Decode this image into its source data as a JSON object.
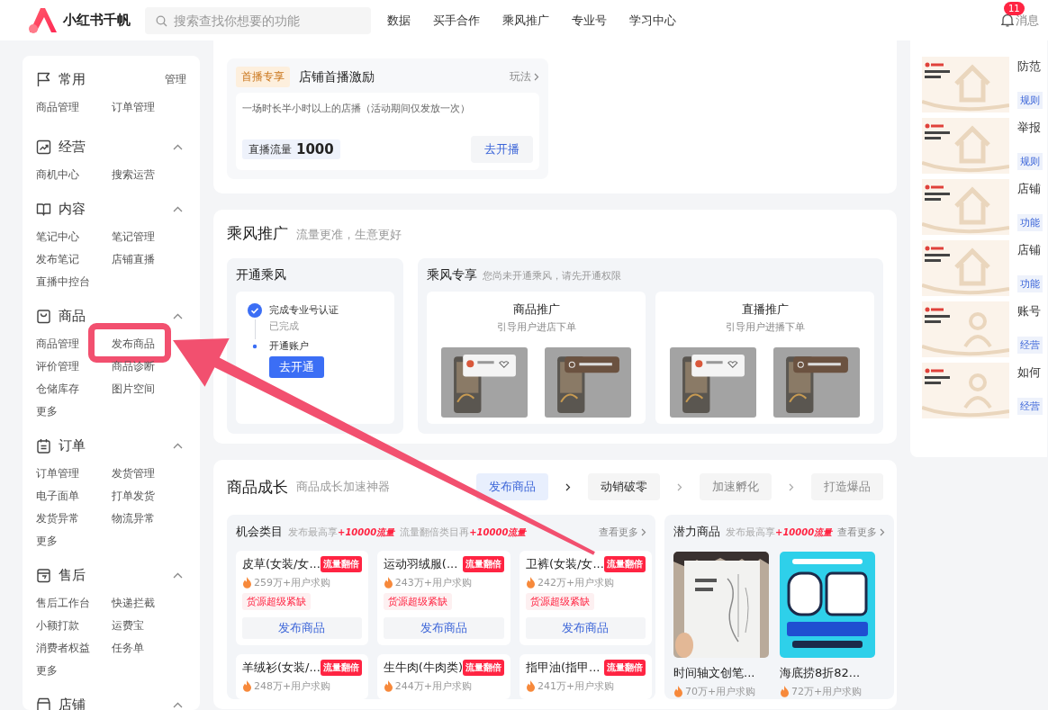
{
  "header": {
    "brand": "小红书千帆",
    "search": {
      "placeholder": "搜索查找你想要的功能"
    },
    "nav": [
      "数据",
      "买手合作",
      "乘风推广",
      "专业号",
      "学习中心"
    ],
    "notifications": {
      "badge": "11",
      "label": "消息"
    }
  },
  "sidebar": {
    "groups": [
      {
        "title": "常用",
        "action": "管理",
        "items": [
          {
            "label": "商品管理",
            "highlighted": false
          },
          {
            "label": "订单管理",
            "highlighted": false
          }
        ]
      },
      {
        "title": "经营",
        "expanded": true,
        "items": [
          {
            "label": "商机中心",
            "highlighted": false
          },
          {
            "label": "搜索运营",
            "highlighted": false
          }
        ]
      },
      {
        "title": "内容",
        "expanded": true,
        "items": [
          {
            "label": "笔记中心",
            "highlighted": false
          },
          {
            "label": "笔记管理",
            "highlighted": false
          },
          {
            "label": "发布笔记",
            "highlighted": false
          },
          {
            "label": "店铺直播",
            "highlighted": false
          },
          {
            "label": "直播中控台",
            "highlighted": false
          }
        ]
      },
      {
        "title": "商品",
        "expanded": true,
        "items": [
          {
            "label": "商品管理",
            "highlighted": false
          },
          {
            "label": "发布商品",
            "highlighted": true
          },
          {
            "label": "评价管理",
            "highlighted": false
          },
          {
            "label": "商品诊断",
            "highlighted": false
          },
          {
            "label": "仓储库存",
            "highlighted": false
          },
          {
            "label": "图片空间",
            "highlighted": false
          },
          {
            "label": "更多",
            "highlighted": false
          }
        ]
      },
      {
        "title": "订单",
        "expanded": true,
        "items": [
          {
            "label": "订单管理",
            "highlighted": false
          },
          {
            "label": "发货管理",
            "highlighted": false
          },
          {
            "label": "电子面单",
            "highlighted": false
          },
          {
            "label": "打单发货",
            "highlighted": false
          },
          {
            "label": "发货异常",
            "highlighted": false
          },
          {
            "label": "物流异常",
            "highlighted": false
          },
          {
            "label": "更多",
            "highlighted": false
          }
        ]
      },
      {
        "title": "售后",
        "expanded": true,
        "items": [
          {
            "label": "售后工作台",
            "highlighted": false
          },
          {
            "label": "快递拦截",
            "highlighted": false
          },
          {
            "label": "小额打款",
            "highlighted": false
          },
          {
            "label": "运费宝",
            "highlighted": false
          },
          {
            "label": "消费者权益",
            "highlighted": false
          },
          {
            "label": "任务单",
            "highlighted": false
          },
          {
            "label": "更多",
            "highlighted": false
          }
        ]
      },
      {
        "title": "店铺",
        "expanded": true
      }
    ]
  },
  "live_incentive": {
    "tag": "首播专享",
    "title": "店铺首播激励",
    "link": "玩法",
    "description": "一场时长半小时以上的店播（活动期间仅发放一次）",
    "reward_label": "直播流量",
    "reward_value": "1000",
    "button": "去开播"
  },
  "promotion": {
    "title": "乘风推广",
    "subtitle": "流量更准，生意更好",
    "activation": {
      "title": "开通乘风",
      "steps": [
        {
          "label": "完成专业号认证",
          "note": "已完成",
          "done": true
        },
        {
          "label": "开通账户",
          "button": "去开通",
          "done": false
        }
      ]
    },
    "exclusive": {
      "title": "乘风专享",
      "subtitle": "您尚未开通乘风，请先开通权限",
      "cards": [
        {
          "title": "商品推广",
          "subtitle": "引导用户进店下单"
        },
        {
          "title": "直播推广",
          "subtitle": "引导用户进播下单"
        }
      ]
    }
  },
  "growth": {
    "title": "商品成长",
    "subtitle": "商品成长加速神器",
    "steps": [
      {
        "label": "发布商品",
        "selected": true,
        "disabled": false
      },
      {
        "label": "动销破零",
        "selected": false,
        "disabled": false
      },
      {
        "label": "加速孵化",
        "selected": false,
        "disabled": true
      },
      {
        "label": "打造爆品",
        "selected": false,
        "disabled": true
      }
    ],
    "opportunities": {
      "title": "机会类目",
      "note": [
        {
          "text": "发布最高享",
          "highlight": false
        },
        {
          "text": "+10000流量",
          "highlight": true
        },
        {
          "text": "流量翻倍类目再",
          "highlight": false
        },
        {
          "text": "+10000流量",
          "highlight": true
        }
      ],
      "more": "查看更多",
      "items": [
        {
          "name": "皮草(女装/女...",
          "badge": "流量翻倍",
          "demand": "259万+用户求购",
          "tag": "货源超级紧缺",
          "button": "发布商品"
        },
        {
          "name": "运动羽绒服(...",
          "badge": "流量翻倍",
          "demand": "243万+用户求购",
          "tag": "货源超级紧缺",
          "button": "发布商品"
        },
        {
          "name": "卫裤(女装/女...",
          "badge": "流量翻倍",
          "demand": "242万+用户求购",
          "tag": "货源超级紧缺",
          "button": "发布商品"
        },
        {
          "name": "羊绒衫(女装/...",
          "badge": "流量翻倍",
          "demand": "248万+用户求购"
        },
        {
          "name": "生牛肉(牛肉类)",
          "badge": "流量翻倍",
          "demand": "244万+用户求购"
        },
        {
          "name": "指甲油(指甲...",
          "badge": "流量翻倍",
          "demand": "241万+用户求购"
        }
      ]
    },
    "potential": {
      "title": "潜力商品",
      "note": [
        {
          "text": "发布最高享",
          "highlight": false
        },
        {
          "text": "+10000流量",
          "highlight": true
        }
      ],
      "more": "查看更多",
      "items": [
        {
          "kind": "picture",
          "name": "时间轴文创笔...",
          "demand": "70万+用户求购"
        },
        {
          "kind": "picture",
          "name": "海底捞8折82...",
          "demand": "72万+用户求购"
        }
      ]
    }
  },
  "learning": {
    "items": [
      {
        "title": "防范",
        "tag": "规则"
      },
      {
        "title": "举报",
        "tag": "规则"
      },
      {
        "title": "店铺",
        "tag": "功能"
      },
      {
        "title": "店铺",
        "tag": "功能"
      },
      {
        "title": "账号",
        "tag": "经营"
      },
      {
        "title": "如何",
        "tag": "经营"
      }
    ]
  }
}
